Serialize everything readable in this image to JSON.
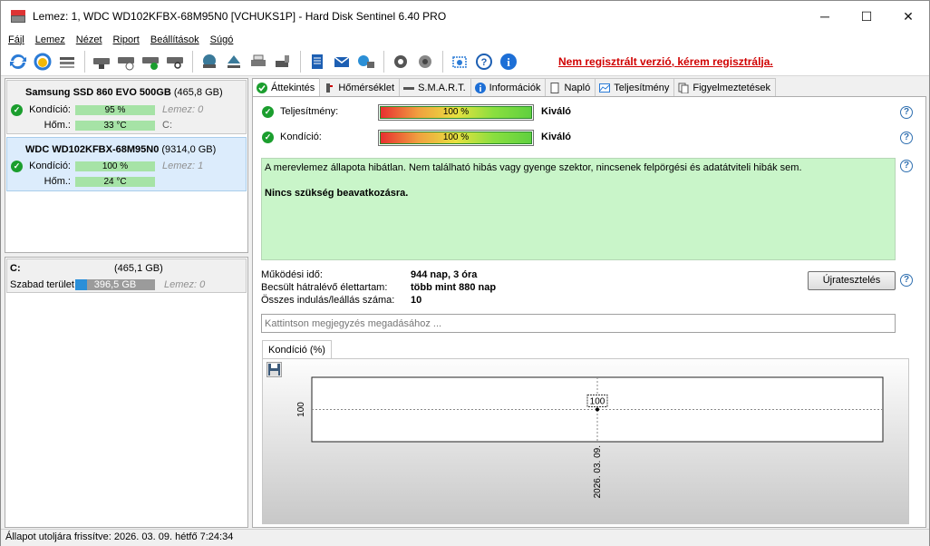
{
  "window": {
    "title": "Lemez: 1, WDC WD102KFBX-68M95N0 [VCHUKS1P]  -  Hard Disk Sentinel 6.40 PRO",
    "minimize": "─",
    "maximize": "☐",
    "close": "✕"
  },
  "menu": [
    "Fájl",
    "Lemez",
    "Nézet",
    "Riport",
    "Beállítások",
    "Súgó"
  ],
  "toolbar": {
    "register_link": "Nem regisztrált verzió, kérem regisztrálja."
  },
  "disks": [
    {
      "name": "Samsung SSD 860 EVO 500GB",
      "size": "(465,8 GB)",
      "condition_label": "Kondíció:",
      "condition": "95 %",
      "condition_extra": "Lemez: 0",
      "temp_label": "Hőm.:",
      "temp": "33 °C",
      "temp_extra": "C:"
    },
    {
      "name": "WDC WD102KFBX-68M95N0",
      "size": "(9314,0 GB)",
      "condition_label": "Kondíció:",
      "condition": "100 %",
      "condition_extra": "Lemez: 1",
      "temp_label": "Hőm.:",
      "temp": "24 °C",
      "temp_extra": ""
    }
  ],
  "partition": {
    "drive": "C:",
    "size": "(465,1 GB)",
    "free_label": "Szabad terület",
    "free": "396,5 GB",
    "free_fraction": 0.85,
    "disk": "Lemez: 0"
  },
  "tabs": [
    "Áttekintés",
    "Hőmérséklet",
    "S.M.A.R.T.",
    "Információk",
    "Napló",
    "Teljesítmény",
    "Figyelmeztetések"
  ],
  "overview": {
    "performance_label": "Teljesítmény:",
    "performance_value": "100 %",
    "performance_rating": "Kiváló",
    "condition_label": "Kondíció:",
    "condition_value": "100 %",
    "condition_rating": "Kiváló",
    "status_text": "A merevlemez állapota hibátlan. Nem található hibás vagy gyenge szektor, nincsenek felpörgési és adatátviteli hibák sem.",
    "status_action": "Nincs szükség beavatkozásra.",
    "uptime_label": "Működési idő:",
    "uptime": "944 nap, 3 óra",
    "lifetime_label": "Becsült hátralévő élettartam:",
    "lifetime": "több mint 880 nap",
    "starts_label": "Összes indulás/leállás száma:",
    "starts": "10",
    "retest_button": "Újratesztelés",
    "note_placeholder": "Kattintson megjegyzés megadásához ...",
    "chart_tab": "Kondíció  (%)"
  },
  "chart_data": {
    "type": "line",
    "x": [
      "2026. 03. 09."
    ],
    "series": [
      {
        "values": [
          100
        ]
      }
    ],
    "point_labels": [
      "100"
    ],
    "ytick_labels": [
      "100"
    ],
    "xtick_labels": [
      "2026. 03. 09."
    ]
  },
  "statusbar": "Állapot utoljára frissítve: 2026. 03. 09. hétfő 7:24:34"
}
